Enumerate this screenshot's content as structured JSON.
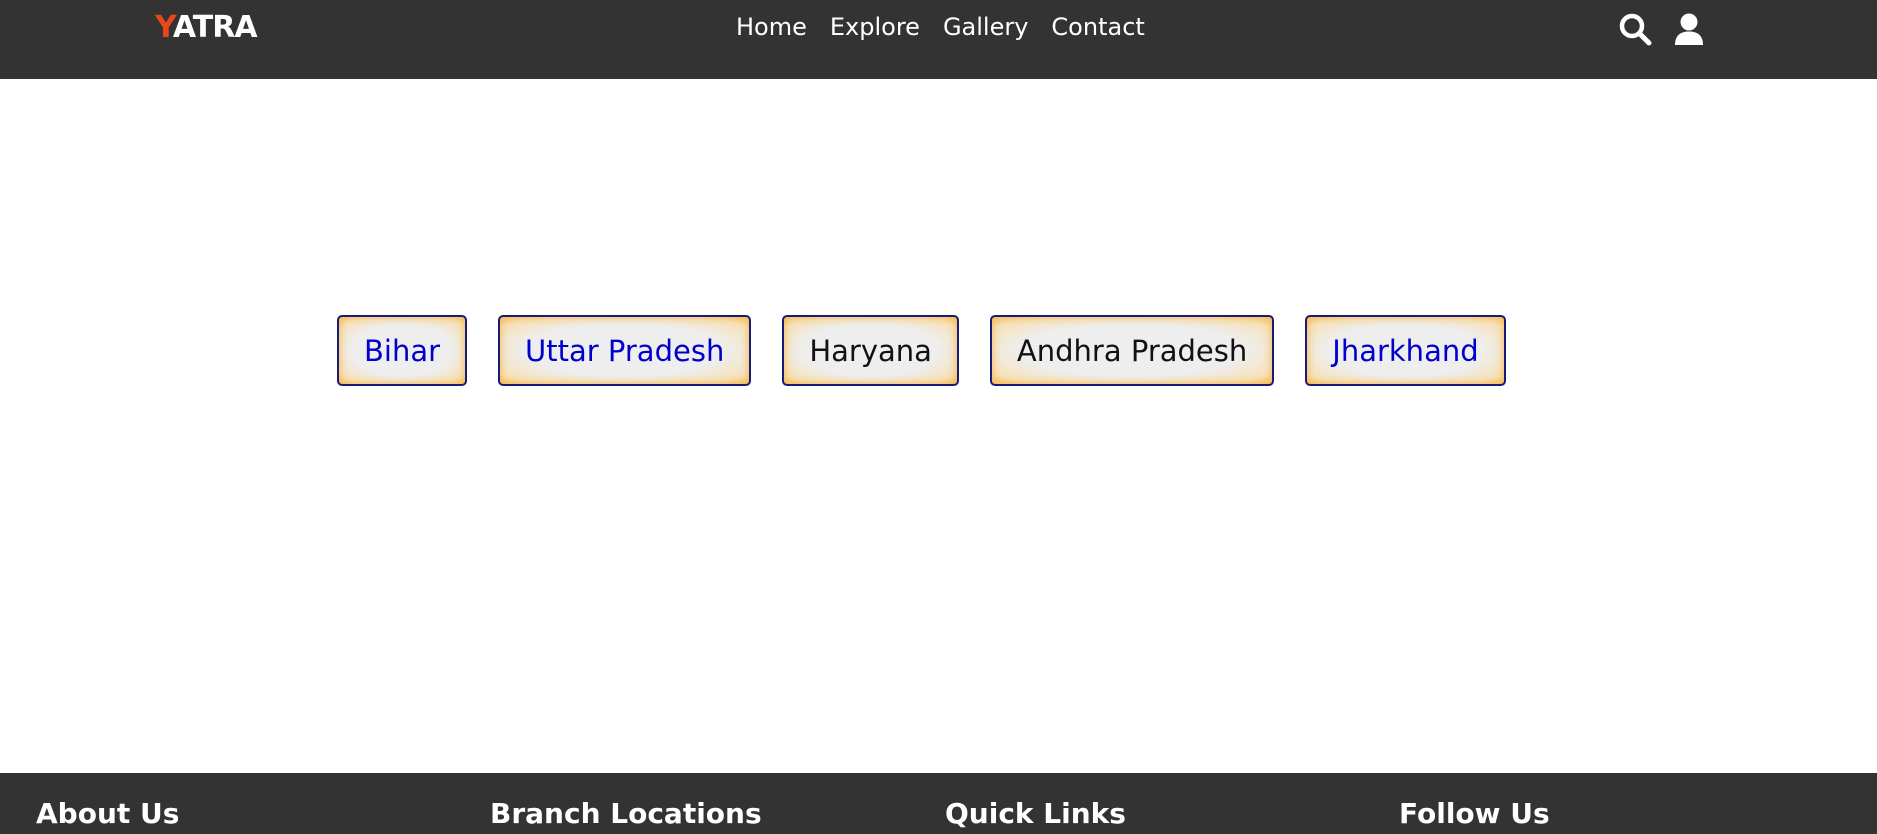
{
  "navbar": {
    "logo": {
      "accent_letter": "Y",
      "rest": "ATRA"
    },
    "links": [
      "Home",
      "Explore",
      "Gallery",
      "Contact"
    ],
    "icons": [
      "search-icon",
      "user-icon"
    ]
  },
  "states": [
    {
      "label": "Bihar",
      "style": "link"
    },
    {
      "label": "Uttar Pradesh",
      "style": "link"
    },
    {
      "label": "Haryana",
      "style": "plain"
    },
    {
      "label": "Andhra Pradesh",
      "style": "plain"
    },
    {
      "label": "Jharkhand",
      "style": "link"
    }
  ],
  "footer": {
    "headings": [
      "About Us",
      "Branch Locations",
      "Quick Links",
      "Follow Us"
    ]
  },
  "colors": {
    "header_bg": "#333333",
    "logo_accent": "#e8471a",
    "link_text": "#0000cc",
    "button_border": "#1a1a7a",
    "button_glow": "#f5b547"
  }
}
